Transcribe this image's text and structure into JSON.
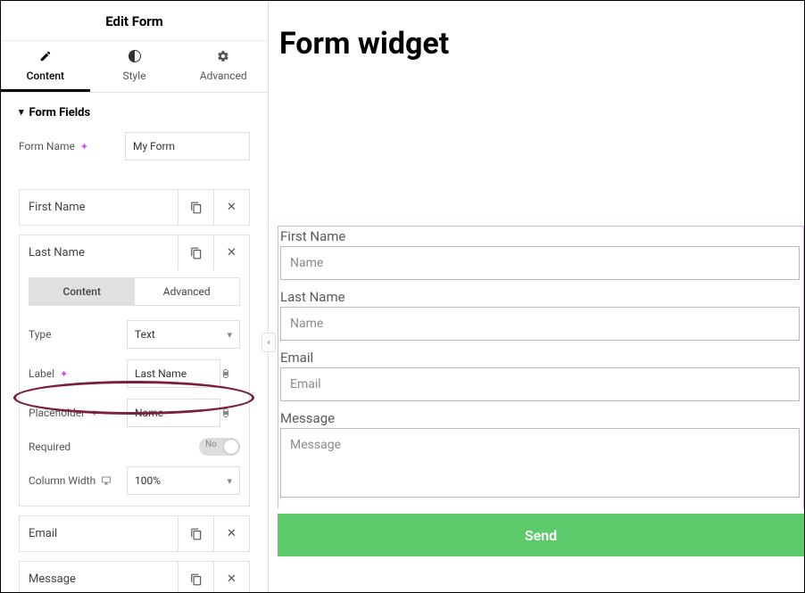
{
  "panel": {
    "title": "Edit Form",
    "tabs": {
      "content": "Content",
      "style": "Style",
      "advanced": "Advanced"
    }
  },
  "sections": {
    "form_fields": "Form Fields"
  },
  "formName": {
    "label": "Form Name",
    "value": "My Form"
  },
  "fieldCards": {
    "firstName": "First Name",
    "lastName": "Last Name",
    "email": "Email",
    "message": "Message"
  },
  "innerTabs": {
    "content": "Content",
    "advanced": "Advanced"
  },
  "props": {
    "type": {
      "label": "Type",
      "value": "Text"
    },
    "label": {
      "label": "Label",
      "value": "Last Name"
    },
    "placeholder": {
      "label": "Placeholder",
      "value": "Name"
    },
    "required": {
      "label": "Required",
      "value": "No"
    },
    "columnWidth": {
      "label": "Column Width",
      "value": "100%"
    }
  },
  "preview": {
    "title": "Form widget",
    "fields": [
      {
        "label": "First Name",
        "placeholder": "Name"
      },
      {
        "label": "Last Name",
        "placeholder": "Name"
      },
      {
        "label": "Email",
        "placeholder": "Email"
      },
      {
        "label": "Message",
        "placeholder": "Message"
      }
    ],
    "submit": "Send"
  }
}
